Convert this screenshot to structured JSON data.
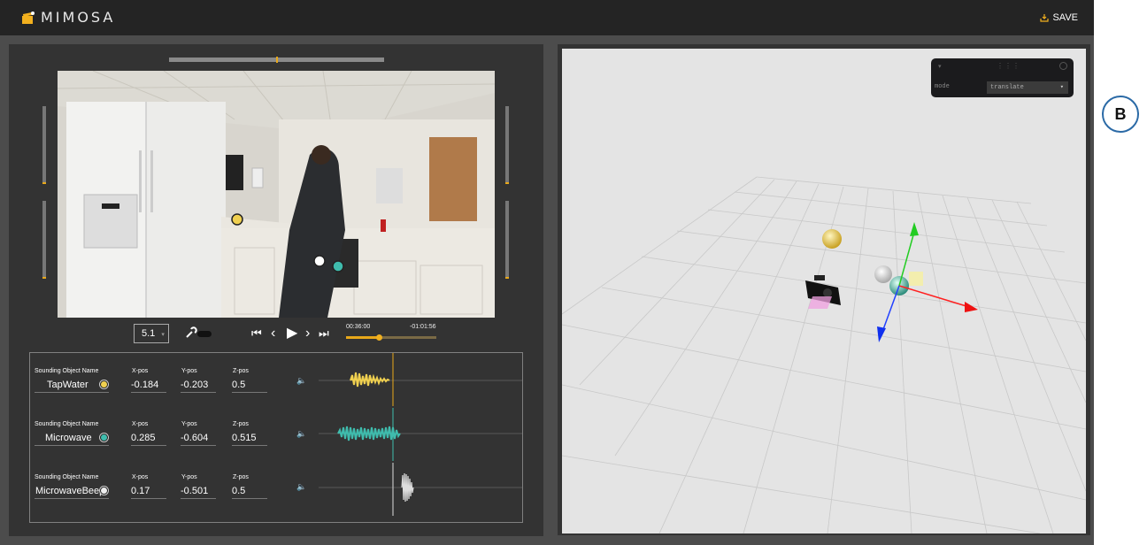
{
  "app": {
    "title": "MIMOSA",
    "save_label": "SAVE",
    "colors": {
      "accent": "#e8a81a",
      "header_bg": "#242424",
      "panel_bg": "#333333"
    }
  },
  "player": {
    "speed_label": "5.1",
    "current_time": "00:36:00",
    "remaining_time": "-01:01:56",
    "progress": 0.37
  },
  "tracks": {
    "name_label": "Sounding Object Name",
    "x_label": "X-pos",
    "y_label": "Y-pos",
    "z_label": "Z-pos",
    "rows": [
      {
        "name": "TapWater",
        "x": "-0.184",
        "y": "-0.203",
        "z": "0.5",
        "color": "#f0d050"
      },
      {
        "name": "Microwave",
        "x": "0.285",
        "y": "-0.604",
        "z": "0.515",
        "color": "#3fbcad"
      },
      {
        "name": "MicrowaveBeep",
        "x": "0.17",
        "y": "-0.501",
        "z": "0.5",
        "color": "#eeeeee"
      }
    ]
  },
  "gui": {
    "mode_label": "mode",
    "mode_value": "translate"
  },
  "annotation": {
    "badge": "B"
  }
}
